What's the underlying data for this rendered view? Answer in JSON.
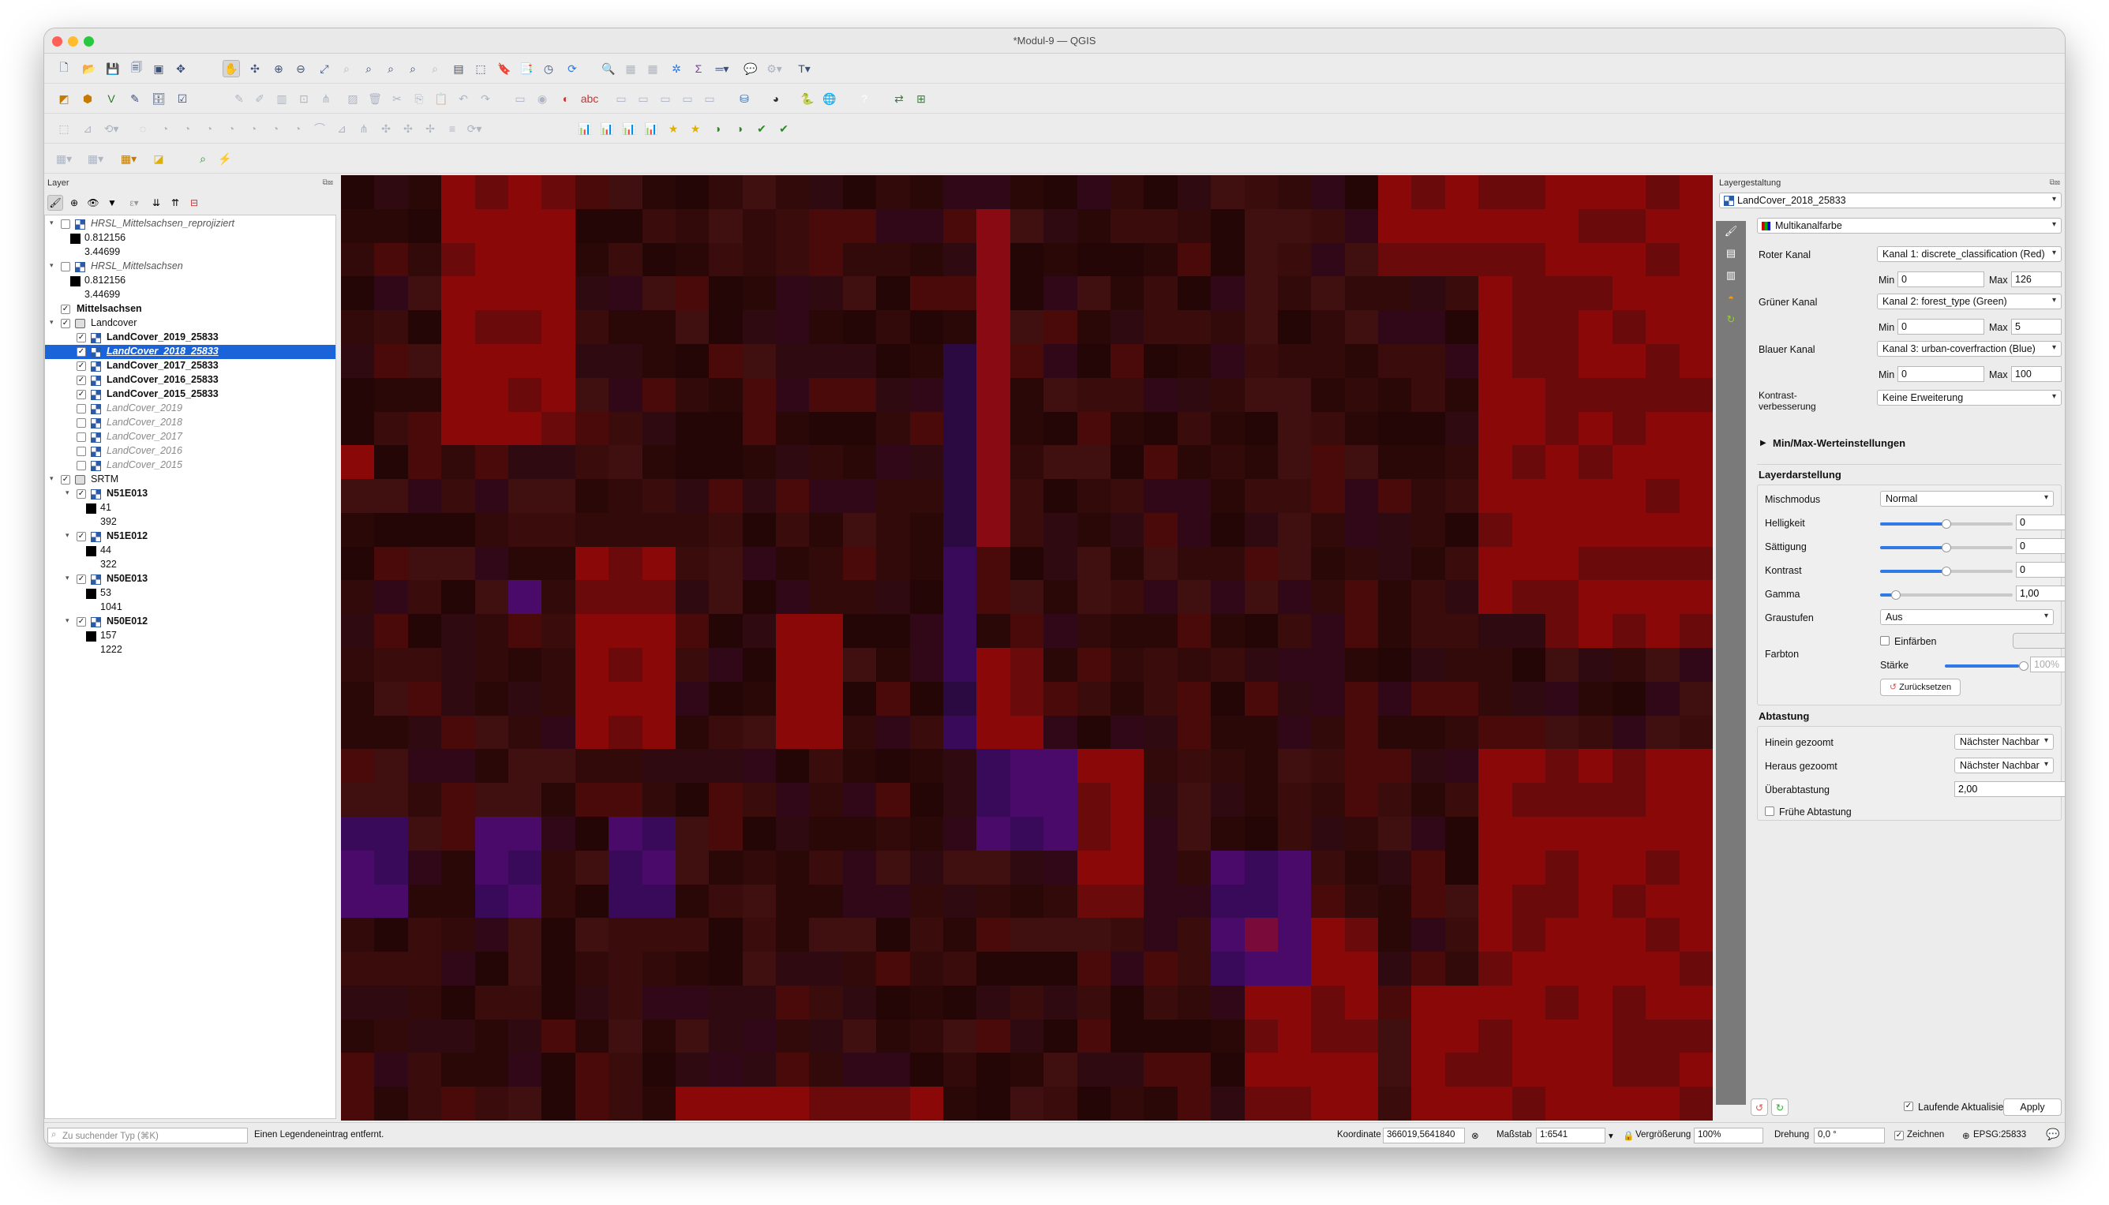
{
  "window": {
    "title": "*Modul-9 — QGIS"
  },
  "layers_panel": {
    "title": "Layer",
    "rows": [
      {
        "label": "HRSL_Mittelsachsen_reprojiziert",
        "style": "italic",
        "checked": false,
        "level": 0,
        "expanded": true,
        "icon": "raster"
      },
      {
        "label": "0.812156",
        "style": "legend",
        "level": 1,
        "swatch": true
      },
      {
        "label": "3.44699",
        "style": "legend",
        "level": 1
      },
      {
        "label": "HRSL_Mittelsachsen",
        "style": "italic",
        "checked": false,
        "level": 0,
        "expanded": true,
        "icon": "raster"
      },
      {
        "label": "0.812156",
        "style": "legend",
        "level": 1,
        "swatch": true
      },
      {
        "label": "3.44699",
        "style": "legend",
        "level": 1
      },
      {
        "label": "Mittelsachsen",
        "style": "bold",
        "checked": true,
        "level": 0,
        "icon": "none"
      },
      {
        "label": "Landcover",
        "style": "normal",
        "checked": true,
        "level": 0,
        "expanded": true,
        "icon": "group"
      },
      {
        "label": "LandCover_2019_25833",
        "style": "bold",
        "checked": true,
        "level": 1,
        "icon": "raster"
      },
      {
        "label": "LandCover_2018_25833",
        "style": "bold",
        "checked": true,
        "level": 1,
        "icon": "raster",
        "selected": true
      },
      {
        "label": "LandCover_2017_25833",
        "style": "bold",
        "checked": true,
        "level": 1,
        "icon": "raster"
      },
      {
        "label": "LandCover_2016_25833",
        "style": "bold",
        "checked": true,
        "level": 1,
        "icon": "raster"
      },
      {
        "label": "LandCover_2015_25833",
        "style": "bold",
        "checked": true,
        "level": 1,
        "icon": "raster"
      },
      {
        "label": "LandCover_2019",
        "style": "gray",
        "checked": false,
        "level": 1,
        "icon": "raster"
      },
      {
        "label": "LandCover_2018",
        "style": "gray",
        "checked": false,
        "level": 1,
        "icon": "raster"
      },
      {
        "label": "LandCover_2017",
        "style": "gray",
        "checked": false,
        "level": 1,
        "icon": "raster"
      },
      {
        "label": "LandCover_2016",
        "style": "gray",
        "checked": false,
        "level": 1,
        "icon": "raster"
      },
      {
        "label": "LandCover_2015",
        "style": "gray",
        "checked": false,
        "level": 1,
        "icon": "raster"
      },
      {
        "label": "SRTM",
        "style": "normal",
        "checked": true,
        "level": 0,
        "expanded": true,
        "icon": "group"
      },
      {
        "label": "N51E013",
        "style": "bold",
        "checked": true,
        "level": 1,
        "expanded": true,
        "icon": "raster"
      },
      {
        "label": "41",
        "style": "legend",
        "level": 2,
        "swatch": true
      },
      {
        "label": "392",
        "style": "legend",
        "level": 2
      },
      {
        "label": "N51E012",
        "style": "bold",
        "checked": true,
        "level": 1,
        "expanded": true,
        "icon": "raster"
      },
      {
        "label": "44",
        "style": "legend",
        "level": 2,
        "swatch": true
      },
      {
        "label": "322",
        "style": "legend",
        "level": 2
      },
      {
        "label": "N50E013",
        "style": "bold",
        "checked": true,
        "level": 1,
        "expanded": true,
        "icon": "raster"
      },
      {
        "label": "53",
        "style": "legend",
        "level": 2,
        "swatch": true
      },
      {
        "label": "1041",
        "style": "legend",
        "level": 2
      },
      {
        "label": "N50E012",
        "style": "bold",
        "checked": true,
        "level": 1,
        "expanded": true,
        "icon": "raster"
      },
      {
        "label": "157",
        "style": "legend",
        "level": 2,
        "swatch": true
      },
      {
        "label": "1222",
        "style": "legend",
        "level": 2
      }
    ]
  },
  "styling_panel": {
    "title": "Layergestaltung",
    "layer_select": "LandCover_2018_25833",
    "renderer": "Multikanalfarbe",
    "red_label": "Roter Kanal",
    "red_band": "Kanal 1: discrete_classification (Red)",
    "red_min": "0",
    "red_max": "126",
    "green_label": "Grüner Kanal",
    "green_band": "Kanal 2: forest_type (Green)",
    "green_min": "0",
    "green_max": "5",
    "blue_label": "Blauer Kanal",
    "blue_band": "Kanal 3: urban-coverfraction (Blue)",
    "blue_min": "0",
    "blue_max": "100",
    "min_label": "Min",
    "max_label": "Max",
    "contrast_label_1": "Kontrast-",
    "contrast_label_2": "verbesserung",
    "contrast_value": "Keine Erweiterung",
    "minmax_section": "Min/Max-Werteinstellungen",
    "rendering_section": "Layerdarstellung",
    "blend_label": "Mischmodus",
    "blend_value": "Normal",
    "brightness_label": "Helligkeit",
    "brightness_value": "0",
    "saturation_label": "Sättigung",
    "saturation_value": "0",
    "contrast2_label": "Kontrast",
    "contrast2_value": "0",
    "gamma_label": "Gamma",
    "gamma_value": "1,00",
    "grayscale_label": "Graustufen",
    "grayscale_value": "Aus",
    "hue_label": "Farbton",
    "colorize_label": "Einfärben",
    "strength_label": "Stärke",
    "strength_value": "100%",
    "reset_label": "Zurücksetzen",
    "resampling_section": "Abtastung",
    "zoomed_in_label": "Hinein gezoomt",
    "zoomed_in_value": "Nächster Nachbar",
    "zoomed_out_label": "Heraus gezoomt",
    "zoomed_out_value": "Nächster Nachbar",
    "oversampling_label": "Überabtastung",
    "oversampling_value": "2,00",
    "early_label": "Frühe Abtastung",
    "live_update_label": "Laufende Aktualisierung",
    "apply_label": "Apply"
  },
  "statusbar": {
    "search_placeholder": "Zu suchender Typ (⌘K)",
    "message": "Einen Legendeneintrag entfernt.",
    "coord_label": "Koordinate",
    "coord_value": "366019,5641840",
    "scale_label": "Maßstab",
    "scale_value": "1:6541",
    "magnifier_label": "Vergrößerung",
    "magnifier_value": "100%",
    "rotation_label": "Drehung",
    "rotation_value": "0,0 °",
    "render_label": "Zeichnen",
    "crs_label": "EPSG:25833"
  },
  "colors": {
    "selection": "#1a63d9",
    "map_dark": "#2a0808",
    "map_red": "#8a0808",
    "map_purple": "#3a0a5a"
  }
}
